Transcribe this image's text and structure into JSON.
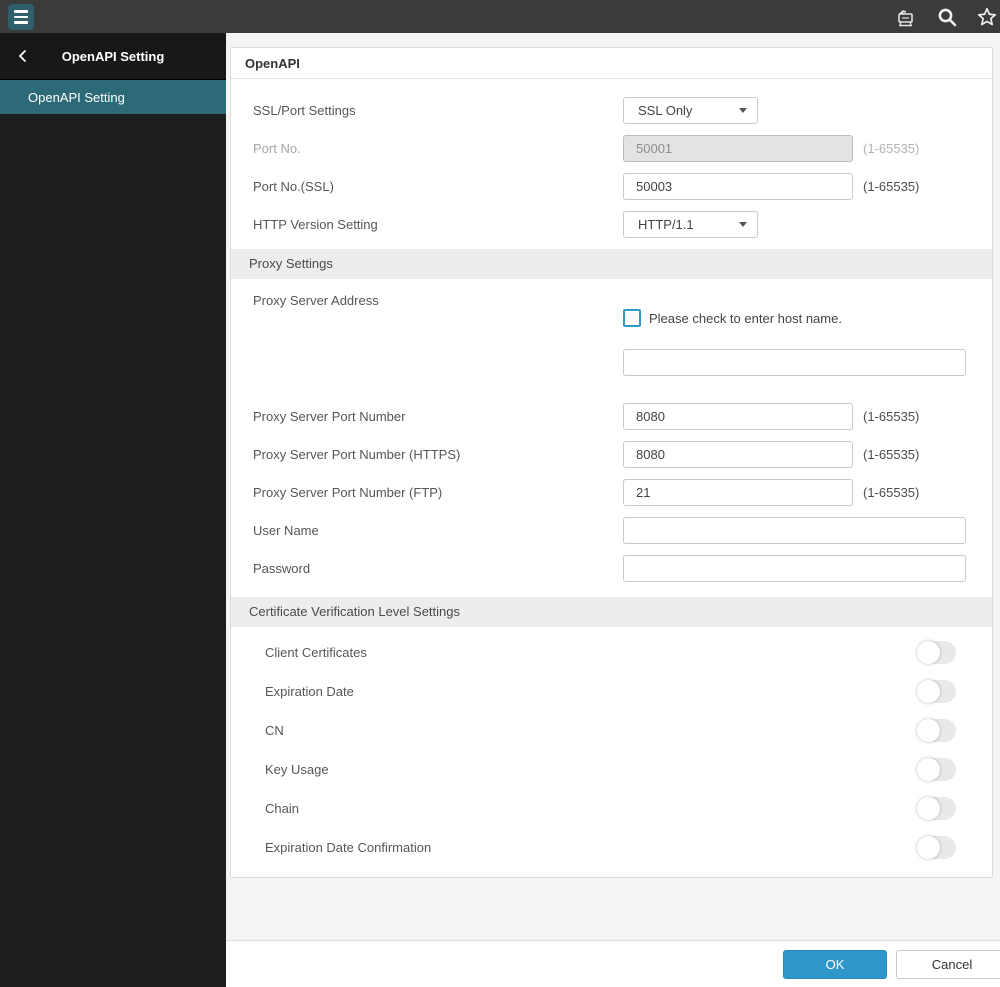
{
  "topbar": {
    "icons": [
      "hamburger-icon",
      "printer-icon",
      "search-icon",
      "star-icon"
    ]
  },
  "sidebar": {
    "back_icon": "chevron-left-icon",
    "title": "OpenAPI Setting",
    "items": [
      {
        "label": "OpenAPI Setting",
        "selected": true
      }
    ]
  },
  "main": {
    "title": "OpenAPI",
    "ssl_port": {
      "label": "SSL/Port Settings",
      "value": "SSL Only"
    },
    "port_no": {
      "label": "Port No.",
      "value": "50001",
      "hint": "(1-65535)",
      "disabled": true
    },
    "port_ssl": {
      "label": "Port No.(SSL)",
      "value": "50003",
      "hint": "(1-65535)"
    },
    "http_version": {
      "label": "HTTP Version Setting",
      "value": "HTTP/1.1"
    },
    "sections": {
      "proxy": "Proxy Settings",
      "certificate": "Certificate Verification Level Settings"
    },
    "proxy_address": {
      "label": "Proxy Server Address",
      "checkbox_label": "Please check to enter host name.",
      "checked": false,
      "value": ""
    },
    "proxy_port": {
      "label": "Proxy Server Port Number",
      "value": "8080",
      "hint": "(1-65535)"
    },
    "proxy_port_https": {
      "label": "Proxy Server Port Number (HTTPS)",
      "value": "8080",
      "hint": "(1-65535)"
    },
    "proxy_port_ftp": {
      "label": "Proxy Server Port Number (FTP)",
      "value": "21",
      "hint": "(1-65535)"
    },
    "user_name": {
      "label": "User Name",
      "value": ""
    },
    "password": {
      "label": "Password",
      "value": ""
    },
    "toggles": [
      {
        "label": "Client Certificates",
        "on": false
      },
      {
        "label": "Expiration Date",
        "on": false
      },
      {
        "label": "CN",
        "on": false
      },
      {
        "label": "Key Usage",
        "on": false
      },
      {
        "label": "Chain",
        "on": false
      },
      {
        "label": "Expiration Date Confirmation",
        "on": false
      }
    ]
  },
  "footer": {
    "ok_label": "OK",
    "cancel_label": "Cancel"
  },
  "colors": {
    "topbar": "#3b3b3b",
    "sidebar": "#1e1e1e",
    "accent_teal": "#2d6a78",
    "ok_blue": "#2e96c8",
    "checkbox_blue": "#2f9ace"
  }
}
